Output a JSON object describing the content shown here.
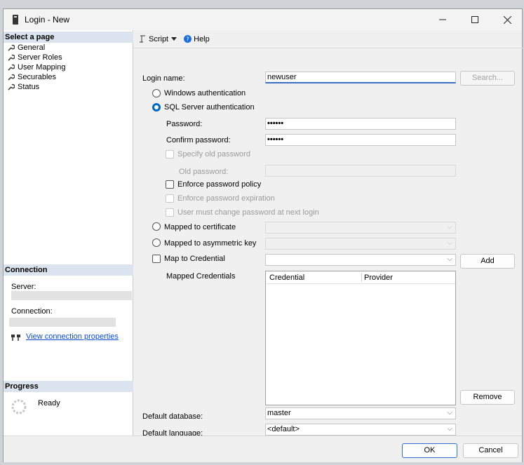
{
  "window": {
    "title": "Login - New",
    "controls": {
      "minimize": "minimize-icon",
      "maximize": "maximize-icon",
      "close": "close-icon"
    }
  },
  "left": {
    "select_page_header": "Select a page",
    "pages": [
      "General",
      "Server Roles",
      "User Mapping",
      "Securables",
      "Status"
    ],
    "connection_header": "Connection",
    "server_label": "Server:",
    "connection_label": "Connection:",
    "view_connection_link": "View connection properties",
    "progress_header": "Progress",
    "progress_status": "Ready"
  },
  "toolbar": {
    "script_label": "Script",
    "help_label": "Help"
  },
  "form": {
    "login_name_label": "Login name:",
    "login_name_value": "newuser",
    "search_button": "Search...",
    "windows_auth": "Windows authentication",
    "sql_auth": "SQL Server authentication",
    "password_label": "Password:",
    "password_value": "••••••",
    "confirm_label": "Confirm password:",
    "confirm_value": "••••••",
    "specify_old": "Specify old password",
    "old_password_label": "Old password:",
    "enforce_policy": "Enforce password policy",
    "enforce_expiration": "Enforce password expiration",
    "must_change": "User must change password at next login",
    "mapped_cert": "Mapped to certificate",
    "mapped_asym": "Mapped to asymmetric key",
    "map_credential": "Map to Credential",
    "add_button": "Add",
    "mapped_credentials_label": "Mapped Credentials",
    "cred_columns": [
      "Credential",
      "Provider"
    ],
    "remove_button": "Remove",
    "default_db_label": "Default database:",
    "default_db_value": "master",
    "default_lang_label": "Default language:",
    "default_lang_value": "<default>"
  },
  "footer": {
    "ok": "OK",
    "cancel": "Cancel"
  },
  "colors": {
    "accent": "#0067c0",
    "link": "#0b4bd0",
    "section_bg": "#dbe4ee"
  }
}
